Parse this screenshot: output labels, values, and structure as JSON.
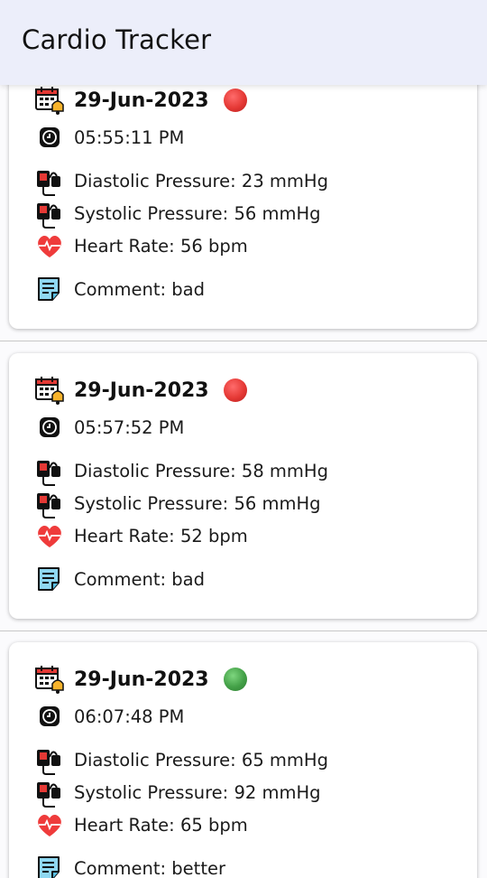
{
  "app": {
    "title": "Cardio Tracker"
  },
  "theme": {
    "appbar_bg": "#eceefa",
    "status_bad": "#e53935",
    "status_good": "#43a047"
  },
  "icons": {
    "date": "calendar-clock-icon",
    "time": "clock-icon",
    "pressure": "blood-pressure-monitor-icon",
    "heart": "heart-rate-icon",
    "comment": "note-icon"
  },
  "records": [
    {
      "date": "29-Jun-2023",
      "status": "bad",
      "status_color": "#e53935",
      "time": "05:55:11 PM",
      "diastolic": "Diastolic Pressure: 23 mmHg",
      "systolic": "Systolic Pressure: 56 mmHg",
      "heart_rate": "Heart Rate: 56 bpm",
      "comment": "Comment: bad"
    },
    {
      "date": "29-Jun-2023",
      "status": "bad",
      "status_color": "#e53935",
      "time": "05:57:52 PM",
      "diastolic": "Diastolic Pressure: 58 mmHg",
      "systolic": "Systolic Pressure: 56 mmHg",
      "heart_rate": "Heart Rate: 52 bpm",
      "comment": "Comment: bad"
    },
    {
      "date": "29-Jun-2023",
      "status": "good",
      "status_color": "#43a047",
      "time": "06:07:48 PM",
      "diastolic": "Diastolic Pressure: 65 mmHg",
      "systolic": "Systolic Pressure: 92 mmHg",
      "heart_rate": "Heart Rate: 65 bpm",
      "comment": "Comment: better"
    }
  ]
}
